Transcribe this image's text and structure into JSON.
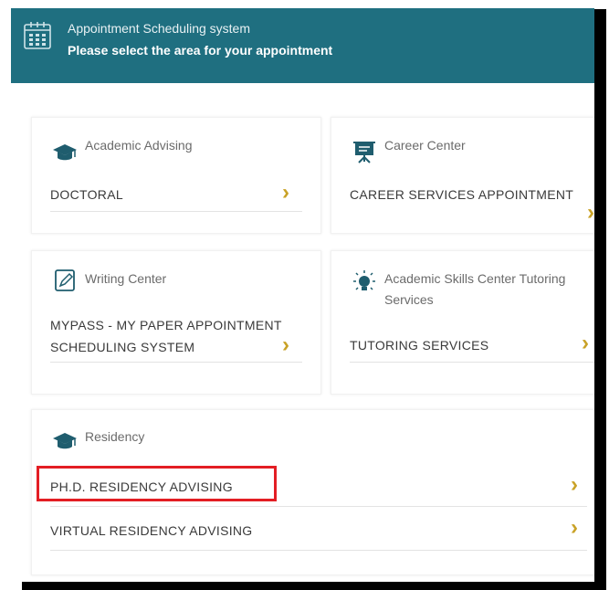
{
  "header": {
    "title": "Appointment Scheduling system",
    "subtitle": "Please select the area for your appointment"
  },
  "cards": {
    "academic_advising": {
      "title": "Academic Advising",
      "items": [
        {
          "label": "DOCTORAL"
        }
      ]
    },
    "career_center": {
      "title": "Career Center",
      "items": [
        {
          "label": "CAREER SERVICES APPOINTMENT"
        }
      ]
    },
    "writing_center": {
      "title": "Writing Center",
      "items": [
        {
          "label_line1": "MYPASS - MY PAPER APPOINTMENT",
          "label_line2": "SCHEDULING SYSTEM"
        }
      ]
    },
    "skills_center": {
      "title_line1": "Academic Skills Center Tutoring",
      "title_line2": "Services",
      "items": [
        {
          "label": "TUTORING SERVICES"
        }
      ]
    },
    "residency": {
      "title": "Residency",
      "items": [
        {
          "label": "PH.D. RESIDENCY ADVISING"
        },
        {
          "label": "VIRTUAL RESIDENCY ADVISING"
        }
      ]
    }
  },
  "chevron": "›",
  "colors": {
    "header": "#1f6f80",
    "accent": "#c9a227",
    "highlight": "#e31e24"
  }
}
